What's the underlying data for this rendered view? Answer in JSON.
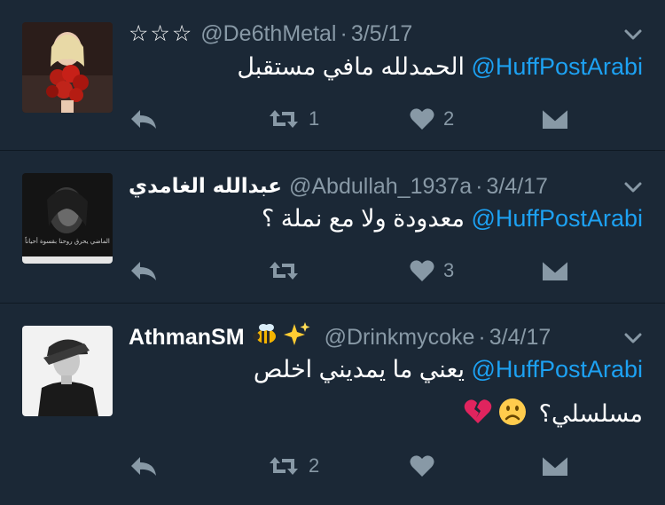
{
  "tweets": [
    {
      "name": "",
      "name_emoji": "☆☆☆",
      "handle": "@De6thMetal",
      "separator": "·",
      "date": "3/5/17",
      "mention": "@HuffPostArabi",
      "text": "الحمدلله مافي مستقبل",
      "reply_count": "",
      "retweet_count": "1",
      "like_count": "2"
    },
    {
      "name": "عبدالله الغامدي",
      "handle": "@Abdullah_1937a",
      "separator": "·",
      "date": "3/4/17",
      "mention": "@HuffPostArabi",
      "text": "معدودة ولا مع نملة ؟",
      "avatar_caption": "الماضي يحرق روحنا بقسوة أحياناً",
      "reply_count": "",
      "retweet_count": "",
      "like_count": "3"
    },
    {
      "name": "AthmanSM",
      "handle": "@Drinkmycoke",
      "separator": "·",
      "date": "3/4/17",
      "mention": "@HuffPostArabi",
      "text": "يعني ما يمديني اخلص",
      "text_line2": "مسلسلي؟",
      "reply_count": "",
      "retweet_count": "2",
      "like_count": ""
    }
  ],
  "icons": {
    "reply": "reply-icon",
    "retweet": "retweet-icon",
    "like": "heart-icon",
    "dm": "envelope-icon",
    "more": "chevron-down-icon"
  },
  "colors": {
    "background": "#1b2836",
    "mention": "#1da1f2",
    "muted": "#8899a6"
  }
}
